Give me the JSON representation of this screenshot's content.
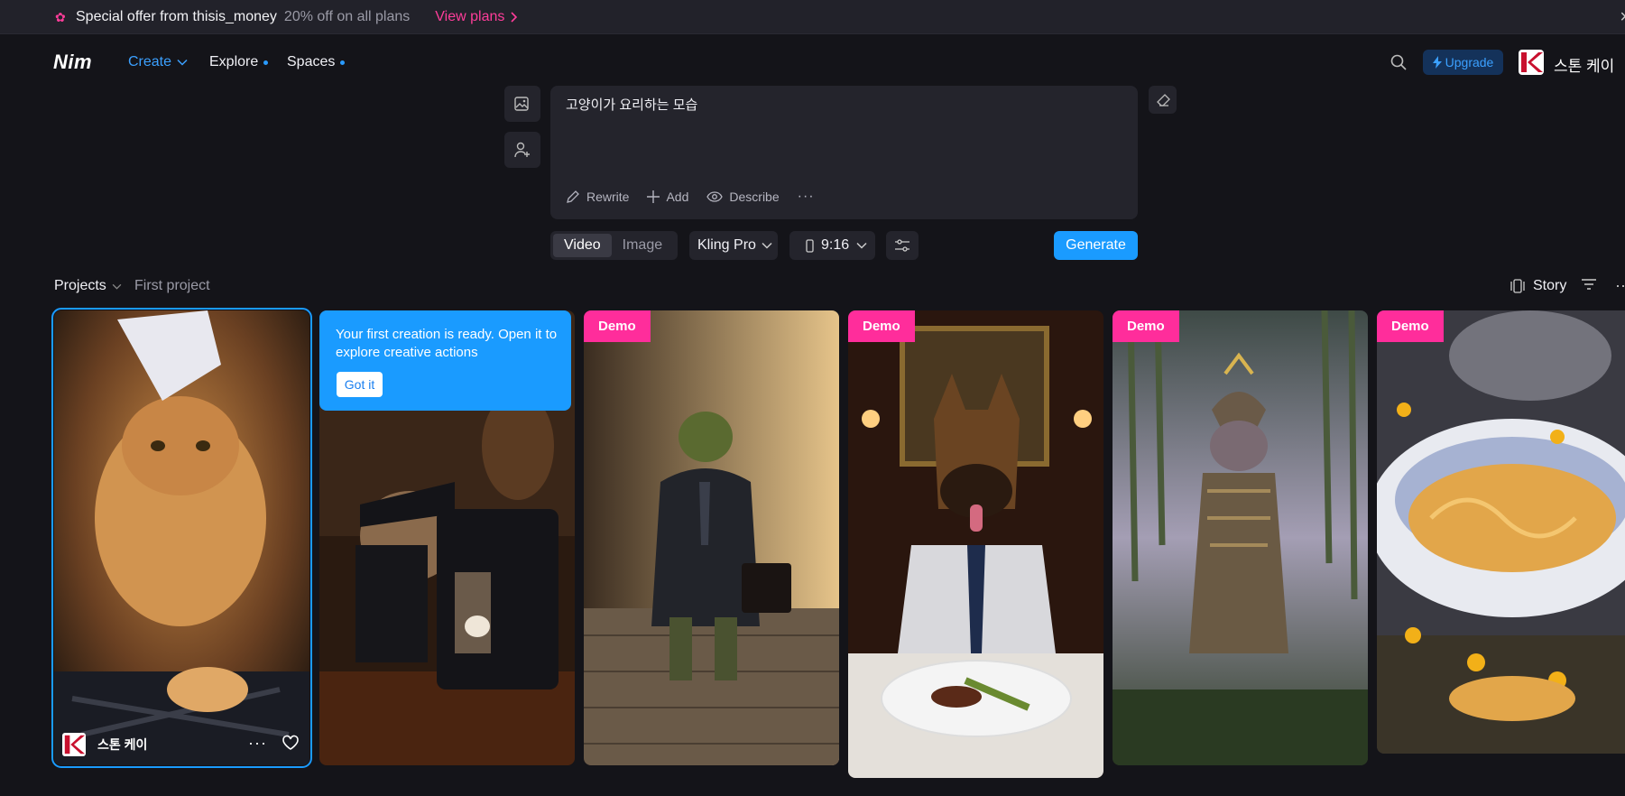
{
  "banner": {
    "offer_text": "Special offer from thisis_money",
    "discount_text": "20% off on all plans",
    "view_plans_label": "View plans"
  },
  "nav": {
    "logo": "Nim",
    "create_label": "Create",
    "explore_label": "Explore",
    "spaces_label": "Spaces",
    "upgrade_label": "Upgrade",
    "user_name": "스톤 케이"
  },
  "prompt": {
    "text": "고양이가 요리하는 모습",
    "tools": [
      "Rewrite",
      "Add",
      "Describe"
    ]
  },
  "controls": {
    "mode_options": [
      "Video",
      "Image"
    ],
    "mode_selected": "Video",
    "model": "Kling Pro",
    "ratio": "9:16",
    "generate_label": "Generate"
  },
  "projects": {
    "projects_label": "Projects",
    "current_project": "First project",
    "story_label": "Story"
  },
  "tooltip": {
    "text": "Your first creation is ready. Open it to explore creative actions",
    "button_label": "Got it"
  },
  "cards": [
    {
      "author": "스톤 케이",
      "badge": "",
      "subject": "cat-chef"
    },
    {
      "author": "",
      "badge": "",
      "subject": "cat-barista"
    },
    {
      "author": "",
      "badge": "Demo",
      "subject": "turtle-businessman"
    },
    {
      "author": "",
      "badge": "Demo",
      "subject": "dog-dinner"
    },
    {
      "author": "",
      "badge": "Demo",
      "subject": "samurai-cat"
    },
    {
      "author": "",
      "badge": "Demo",
      "subject": "noodle-workers"
    }
  ],
  "colors": {
    "accent": "#1a9bff",
    "brand_pink": "#ff2d9b",
    "background": "#141419"
  }
}
